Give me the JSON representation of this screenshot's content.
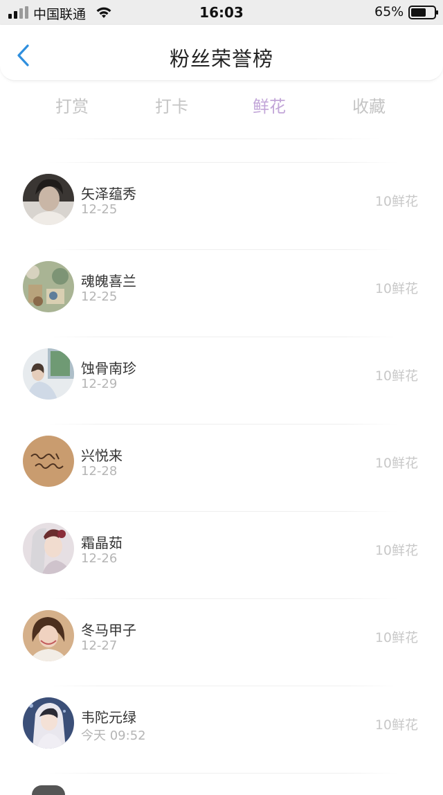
{
  "status_bar": {
    "carrier": "中国联通",
    "time": "16:03",
    "battery": "65%",
    "icons": [
      "signal-icon",
      "wifi-icon",
      "battery-icon"
    ]
  },
  "header": {
    "title": "粉丝荣誉榜",
    "back_icon": "chevron-left-icon"
  },
  "tabs": [
    {
      "label": "打赏",
      "active": false
    },
    {
      "label": "打卡",
      "active": false
    },
    {
      "label": "鲜花",
      "active": true
    },
    {
      "label": "收藏",
      "active": false
    }
  ],
  "colors": {
    "accent": "#c2a6d8",
    "back_icon": "#2f8fde",
    "muted_text": "#c8c8c8"
  },
  "fans": [
    {
      "name": "矢泽蕴秀",
      "date": "12-25",
      "value": "10鲜花"
    },
    {
      "name": "魂魄喜兰",
      "date": "12-25",
      "value": "10鲜花"
    },
    {
      "name": "蚀骨南珍",
      "date": "12-29",
      "value": "10鲜花"
    },
    {
      "name": "兴悦来",
      "date": "12-28",
      "value": "10鲜花"
    },
    {
      "name": "霜晶茹",
      "date": "12-26",
      "value": "10鲜花"
    },
    {
      "name": "冬马甲子",
      "date": "12-27",
      "value": "10鲜花"
    },
    {
      "name": "韦陀元绿",
      "date": "今天 09:52",
      "value": "10鲜花"
    }
  ]
}
